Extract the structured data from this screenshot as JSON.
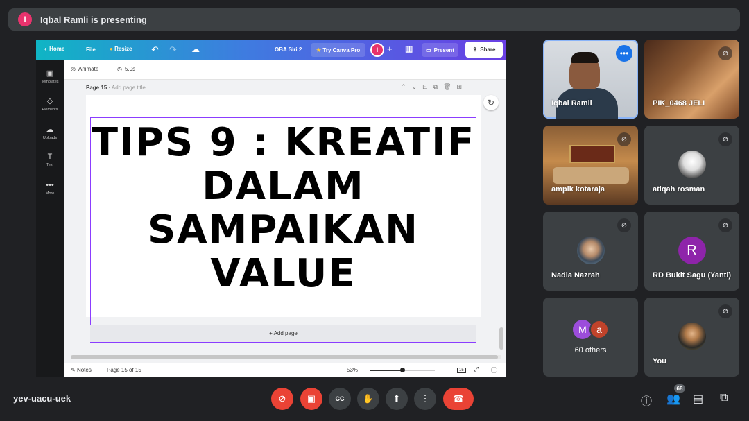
{
  "presenting_banner": {
    "avatar_initial": "I",
    "text": "Iqbal Ramli is presenting"
  },
  "canva": {
    "topbar": {
      "home": "Home",
      "file": "File",
      "resize": "Resize",
      "doc_title": "OBA Siri 2",
      "try_pro": "Try Canva Pro",
      "avatar_initial": "I",
      "present": "Present",
      "share": "Share"
    },
    "sidebar": [
      {
        "label": "Templates",
        "icon": "templates-icon",
        "glyph": "▣"
      },
      {
        "label": "Elements",
        "icon": "elements-icon",
        "glyph": "◇"
      },
      {
        "label": "Uploads",
        "icon": "uploads-icon",
        "glyph": "☁"
      },
      {
        "label": "Text",
        "icon": "text-icon",
        "glyph": "T"
      },
      {
        "label": "More",
        "icon": "more-icon",
        "glyph": "•••"
      }
    ],
    "toolbar": {
      "animate": "Animate",
      "duration": "5.0s"
    },
    "page_label": "Page 15",
    "page_title_placeholder": "Add page title",
    "slide_text": "TIPS 9 : KREATIF DALAM SAMPAIKAN VALUE",
    "add_page": "+ Add page",
    "bottombar": {
      "notes": "Notes",
      "page_count": "Page 15 of 15",
      "zoom": "53%",
      "zoom_fraction": 0.5,
      "grid_count": "15"
    }
  },
  "participants": [
    {
      "name": "Iqbal Ramli",
      "muted": false,
      "active": true
    },
    {
      "name": "PIK_0468 JELI",
      "muted": true
    },
    {
      "name": "ampik kotaraja",
      "muted": true
    },
    {
      "name": "atiqah rosman",
      "muted": true
    },
    {
      "name": "Nadia Nazrah",
      "muted": true
    },
    {
      "name": "RD Bukit Sagu (Yanti)",
      "muted": true,
      "initial": "R"
    },
    {
      "name": "60 others",
      "initials": [
        "M",
        "a"
      ]
    },
    {
      "name": "You",
      "muted": true
    }
  ],
  "meeting": {
    "code": "yev-uacu-uek",
    "people_count": "68"
  },
  "colors": {
    "accent": "#8ab4f8",
    "end_call": "#ea4335",
    "muted_red": "#ea4335",
    "canva_purple": "#8b3dff"
  }
}
